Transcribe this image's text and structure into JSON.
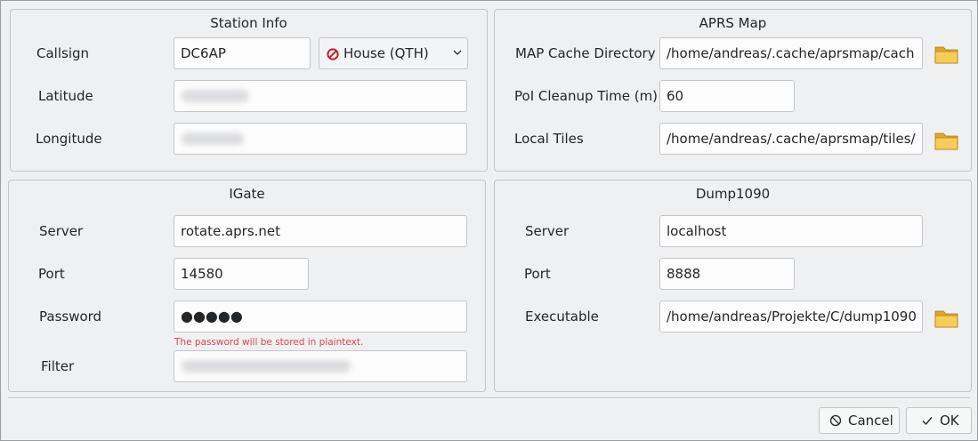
{
  "station_info": {
    "title": "Station Info",
    "callsign_label": "Callsign",
    "callsign_value": "DC6AP",
    "symbol_value": "House (QTH)",
    "latitude_label": "Latitude",
    "longitude_label": "Longitude"
  },
  "aprs_map": {
    "title": "APRS Map",
    "cache_dir_label": "MAP Cache Directory",
    "cache_dir_value": "/home/andreas/.cache/aprsmap/cach",
    "cleanup_label": "PoI Cleanup Time (m)",
    "cleanup_value": "60",
    "tiles_label": "Local Tiles",
    "tiles_value": "/home/andreas/.cache/aprsmap/tiles/"
  },
  "igate": {
    "title": "IGate",
    "server_label": "Server",
    "server_value": "rotate.aprs.net",
    "port_label": "Port",
    "port_value": "14580",
    "password_label": "Password",
    "password_value": "●●●●●",
    "password_note": "The password will be stored in plaintext.",
    "filter_label": "Filter"
  },
  "dump1090": {
    "title": "Dump1090",
    "server_label": "Server",
    "server_value": "localhost",
    "port_label": "Port",
    "port_value": "8888",
    "exec_label": "Executable",
    "exec_value": "/home/andreas/Projekte/C/dump1090"
  },
  "buttons": {
    "cancel_label": "Cancel",
    "ok_label": "OK"
  },
  "colors": {
    "warning": "#da4453",
    "folder": "#f2c34a"
  }
}
